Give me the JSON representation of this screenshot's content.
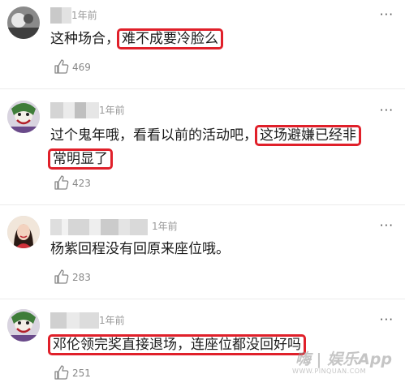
{
  "comments": [
    {
      "time": "1年前",
      "text_plain": "这种场合，",
      "text_highlight": "难不成要冷脸么",
      "likes": "469"
    },
    {
      "time": "1年前",
      "line1_plain": "过个鬼年哦，看看以前的活动吧，",
      "line1_highlight": "这场避嫌已经非",
      "line2_highlight": "常明显了",
      "likes": "423"
    },
    {
      "time": "1年前",
      "text_plain": "杨紫回程没有回原来座位哦。",
      "likes": "283"
    },
    {
      "time": "1年前",
      "text_highlight": "邓伦领完奖直接退场，连座位都没回好吗",
      "likes": "251"
    }
  ],
  "more_icon": "···",
  "watermark": {
    "main": "嗨 | 娱乐App",
    "sub": "WWW.PINQUAN.COM"
  },
  "colors": {
    "highlight_border": "#e0202a",
    "time": "#999999",
    "likes": "#888888"
  }
}
